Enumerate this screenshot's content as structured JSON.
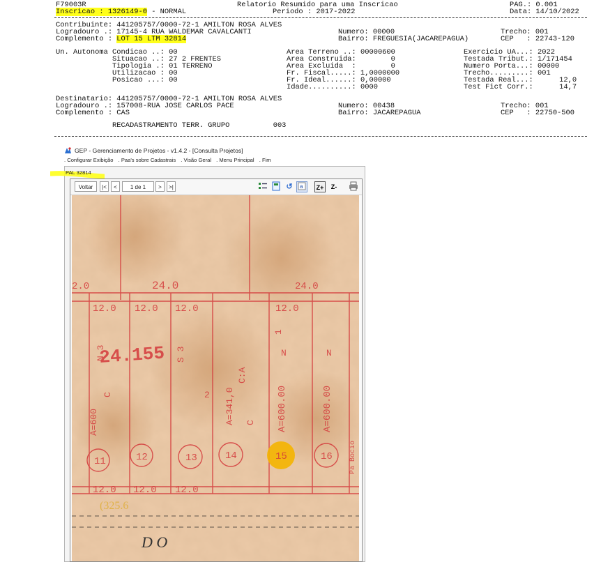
{
  "report": {
    "program": "F79003R",
    "title": "Relatorio Resumido para uma Inscricao",
    "page": "PAG.: 0.001",
    "inscricao": "Inscricao : 1326149-0",
    "status": " - NORMAL",
    "periodo": "Periodo : 2017-2022",
    "data": "Data: 14/10/2022",
    "contribuinte": "Contribuinte: 441205757/0000-72-1 AMILTON ROSA ALVES",
    "logradouro": "Logradouro .: 17145-4 RUA WALDEMAR CAVALCANTI",
    "numero": "Numero: 00000",
    "trecho": "Trecho: 001",
    "complemento_label": "Complemento : ",
    "complemento_value": "LOT 15 LTM 32814",
    "bairro": "Bairro: FREGUESIA(JACAREPAGUA)",
    "cep": "CEP   : 22743-120",
    "col1": "Un. Autonoma Condicao ..: 00\n             Situacao ..: 27 2 FRENTES\n             Tipologia .: 01 TERRENO\n             Utilizacao : 00\n             Posicao ...: 00",
    "col2": "Area Terreno ..: 00000600\nArea Construida:        0\nArea Excluida  :        0\nFr. Fiscal.....: 1,0000000\nFr. Ideal......: 0,00000\nIdade..........: 0000",
    "col3": "Exercicio UA...: 2022\nTestada Tribut.: 1/171454\nNumero Porta...: 00000\nTrecho.........: 001\nTestada Real...:      12,0\nTest Fict Corr.:      14,7",
    "destinatario": "Destinatario: 441205757/0000-72-1 AMILTON ROSA ALVES",
    "dest_logradouro": "Logradouro .: 157008-RUA JOSE CARLOS PACE",
    "dest_numero": "Numero: 00438",
    "dest_trecho": "Trecho: 001",
    "dest_complemento": "Complemento : CAS",
    "dest_bairro": "Bairro: JACAREPAGUA",
    "dest_cep": "CEP   : 22750-500",
    "recad": "RECADASTRAMENTO TERR. GRUPO          003"
  },
  "app": {
    "window_title": "GEP - Gerenciamento de Projetos - v1.4.2 - [Consulta Projetos]",
    "menu": [
      ". Configurar Exibição",
      ". Paa's sobre Cadastrais",
      ". Visão Geral",
      ". Menu Principal",
      ". Fim"
    ],
    "tab_label": "PAL 32814",
    "toolbar": {
      "back": "Voltar",
      "first": "|<",
      "prev": "<",
      "page": "1 de 1",
      "next": ">",
      "last": ">|"
    },
    "icons": [
      "logo-icon",
      "first-page-icon",
      "prev-page-icon",
      "next-page-icon",
      "last-page-icon",
      "layout-icon",
      "fit-page-icon",
      "refresh-icon",
      "text-icon",
      "zoom-in-icon",
      "zoom-out-icon",
      "print-icon"
    ]
  },
  "plan": {
    "top_dims": [
      "2.0",
      "24.0",
      "24.0"
    ],
    "lot_widths_top": [
      "12.0",
      "12.0",
      "12.0",
      "12.0"
    ],
    "lot_widths_bottom": [
      "12.0",
      "12.0",
      "12.0"
    ],
    "pal_number": "24.155",
    "lot_numbers": [
      "11",
      "12",
      "13",
      "14",
      "15",
      "16"
    ],
    "bottom_code": "(325.6",
    "bottom_text": "D O",
    "vertical_texts": [
      "N 3",
      "C",
      "A=600",
      "S 3",
      "A=341,0",
      "C:A",
      "2",
      "C",
      "1",
      "N",
      "A=600.00",
      "N",
      "A=600.00",
      "Pa Bocio"
    ]
  },
  "colors": {
    "highlight": "#ffff1a",
    "paper": "#e8c3a0",
    "ink": "#d4393b",
    "marker": "#f4b400"
  }
}
